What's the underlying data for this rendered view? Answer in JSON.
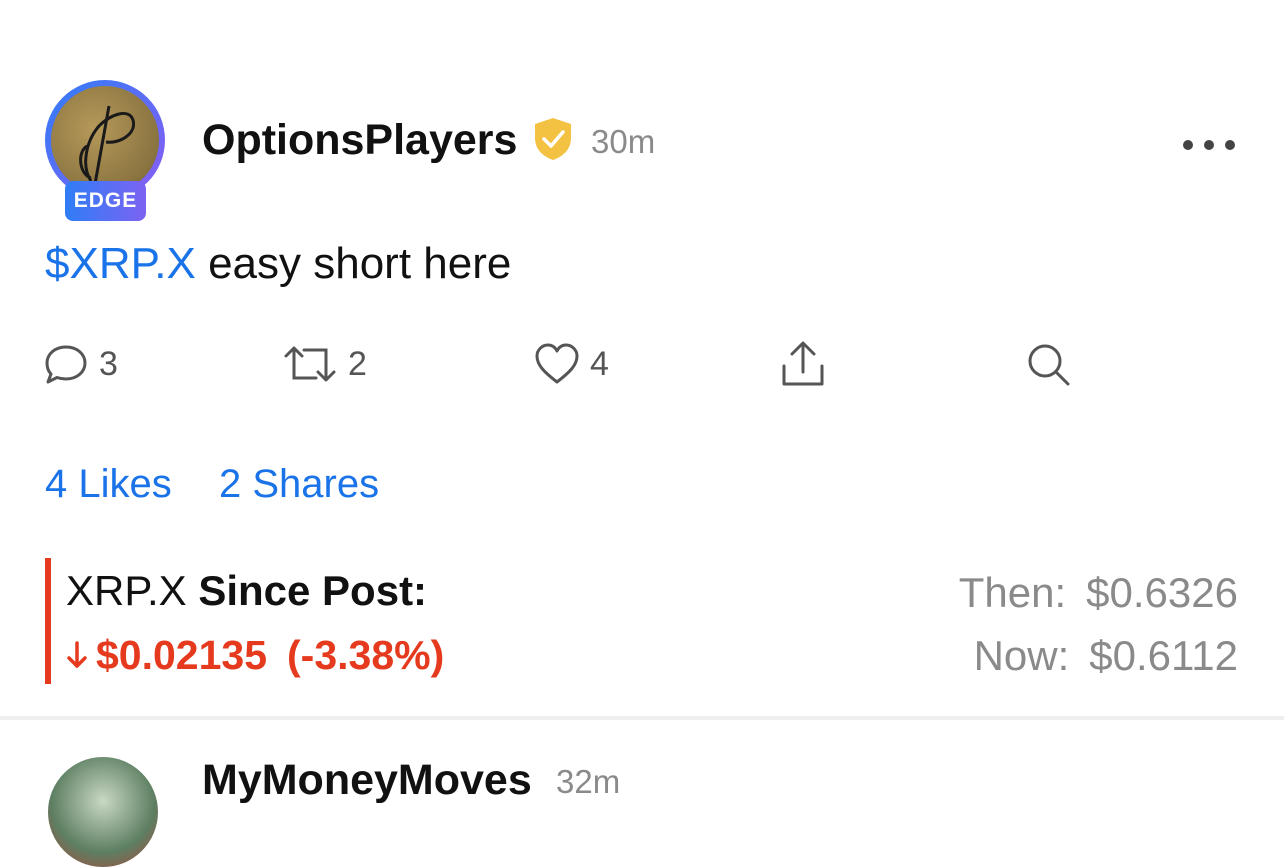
{
  "post": {
    "username": "OptionsPlayers",
    "badge": "EDGE",
    "time": "30m",
    "ticker": "$XRP.X",
    "text": " easy short here",
    "actions": {
      "comments": "3",
      "reshares": "2",
      "likes": "4"
    },
    "likes_link": "4 Likes",
    "shares_link": "2 Shares",
    "performance": {
      "symbol": "XRP.X",
      "since_label": "Since Post:",
      "change": "$0.02135",
      "change_pct": "(-3.38%)",
      "then_label": "Then:",
      "then_value": "$0.6326",
      "now_label": "Now:",
      "now_value": "$0.6112"
    }
  },
  "next_post": {
    "username": "MyMoneyMoves",
    "time": "32m"
  },
  "colors": {
    "accent": "#1a73e8",
    "negative": "#e53a1e",
    "verified": "#f3c243",
    "muted": "#8a8a8a"
  },
  "icons": [
    "back-icon",
    "verified-icon",
    "more-icon",
    "comment-icon",
    "reshare-icon",
    "heart-icon",
    "share-icon",
    "search-icon",
    "down-arrow-icon"
  ]
}
